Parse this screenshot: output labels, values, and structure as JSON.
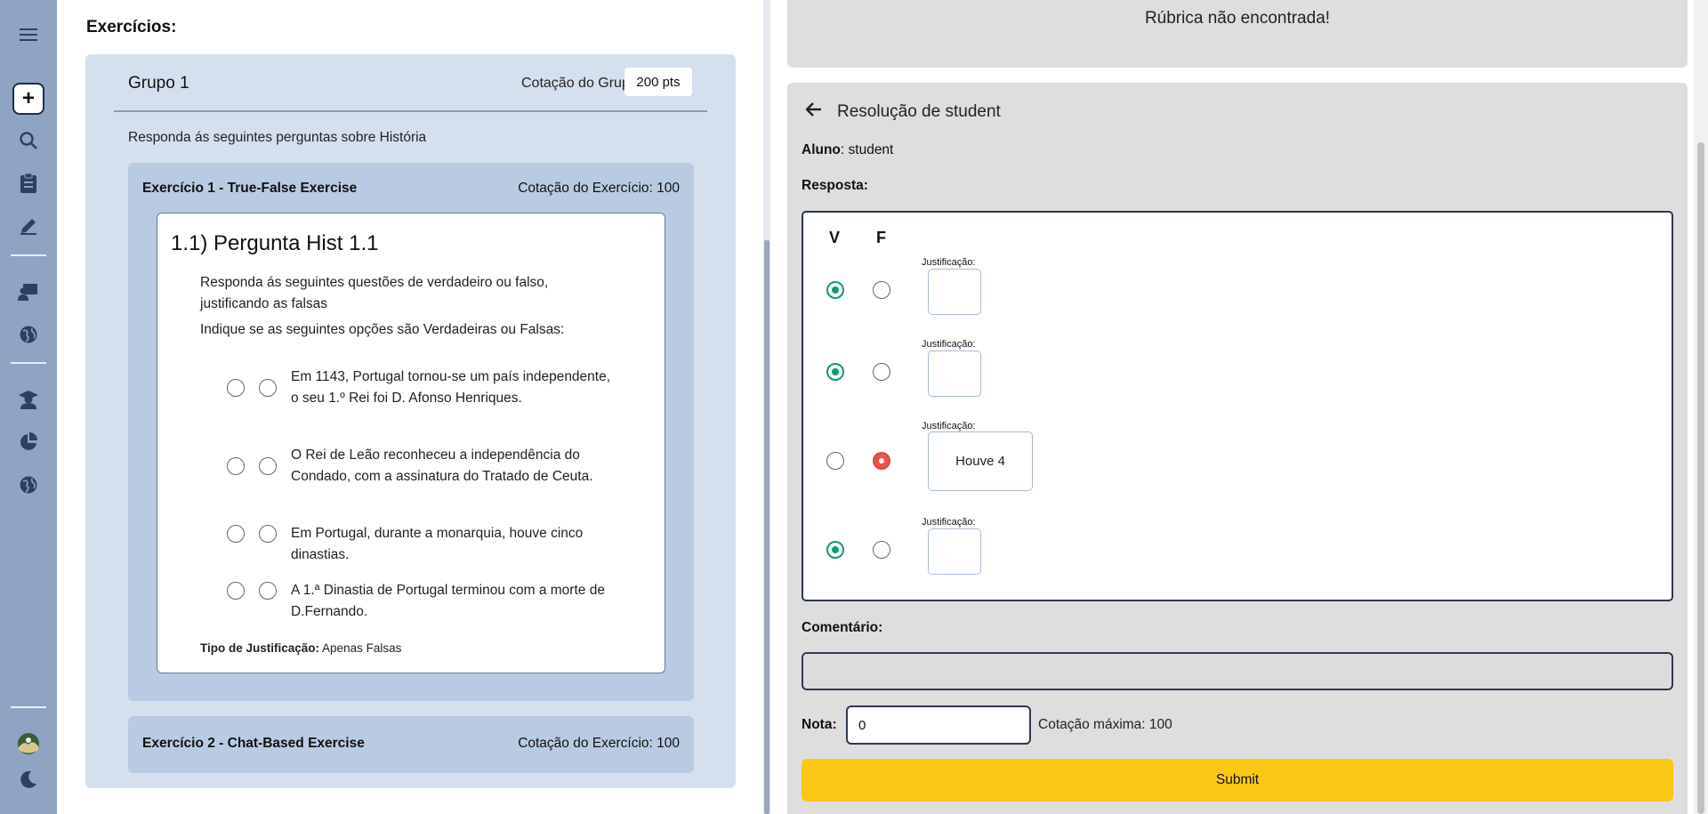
{
  "sidebar": {
    "icons": [
      "menu-icon",
      "plus-icon",
      "search-icon",
      "clipboard-icon",
      "pencil-icon",
      "teacher-icon",
      "globe-icon",
      "student-icon",
      "pie-chart-icon",
      "globe-icon",
      "avatar",
      "moon-icon"
    ],
    "add_label": "+"
  },
  "left": {
    "title": "Exercícios:",
    "group": {
      "title": "Grupo 1",
      "cotacao_label": "Cotação do Grupo:",
      "cotacao_value": "200 pts",
      "description": "Responda ás seguintes perguntas sobre História"
    },
    "exercises": [
      {
        "title": "Exercício 1 - True-False Exercise",
        "cotacao": "Cotação do Exercício: 100",
        "question": {
          "title": "1.1) Pergunta Hist 1.1",
          "text": "Responda ás seguintes questões de verdadeiro ou falso, justificando as falsas",
          "instruction": "Indique se as seguintes opções são Verdadeiras ou Falsas:",
          "options": [
            "Em 1143, Portugal tornou-se um país independente, o seu 1.º Rei foi D. Afonso Henriques.",
            "O Rei de Leão reconheceu a independência do Condado, com a assinatura do Tratado de Ceuta.",
            "Em Portugal, durante a monarquia, houve cinco dinastias.",
            "A 1.ª Dinastia de Portugal terminou com a morte de D.Fernando."
          ],
          "justification_label": "Tipo de Justificação:",
          "justification_value": "Apenas Falsas"
        }
      },
      {
        "title": "Exercício 2 - Chat-Based Exercise",
        "cotacao": "Cotação do Exercício: 100"
      }
    ]
  },
  "right": {
    "rubric_message": "Rúbrica não encontrada!",
    "resolution_title": "Resolução de student",
    "aluno_label": "Aluno",
    "aluno_value": ": student",
    "resposta_label": "Resposta:",
    "header_v": "V",
    "header_f": "F",
    "answers": [
      {
        "selected": "V",
        "justification_label": "Justificação:",
        "justification": ""
      },
      {
        "selected": "V",
        "justification_label": "Justificação:",
        "justification": ""
      },
      {
        "selected": "F",
        "justification_label": "Justificação:",
        "justification": "Houve 4"
      },
      {
        "selected": "V",
        "justification_label": "Justificação:",
        "justification": ""
      }
    ],
    "comentario_label": "Comentário:",
    "nota_label": "Nota:",
    "nota_value": "0",
    "cotacao_maxima": "Cotação máxima: 100",
    "submit_label": "Submit"
  },
  "colors": {
    "sidebar_bg": "#8fa3c3",
    "group_bg": "#d5e0ee",
    "exercise_bg": "#b9cbe3",
    "panel_gray": "#dedede",
    "true_green": "#0f9b6b",
    "false_red": "#f05252",
    "submit_yellow": "#f9c716"
  }
}
